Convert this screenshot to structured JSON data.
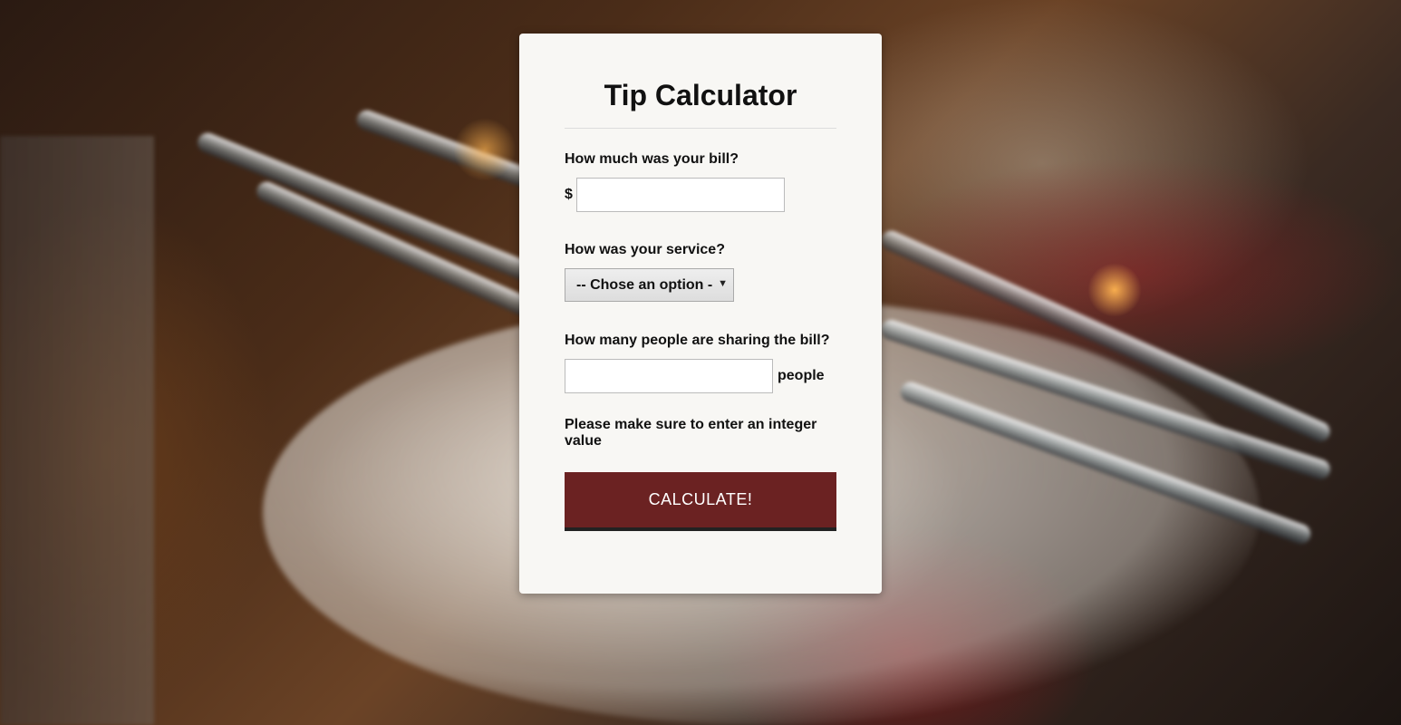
{
  "app": {
    "title": "Tip Calculator"
  },
  "bill": {
    "label": "How much was your bill?",
    "currency_symbol": "$",
    "value": "",
    "placeholder": ""
  },
  "service": {
    "label": "How was your service?",
    "selected": "-- Chose an option --"
  },
  "people": {
    "label": "How many people are sharing the bill?",
    "value": "",
    "placeholder": "",
    "unit": "people"
  },
  "note": "Please make sure to enter an integer value",
  "calculate_button": {
    "label": "CALCULATE!"
  },
  "colors": {
    "button_bg": "#6b2222",
    "card_bg": "#f8f7f4"
  }
}
